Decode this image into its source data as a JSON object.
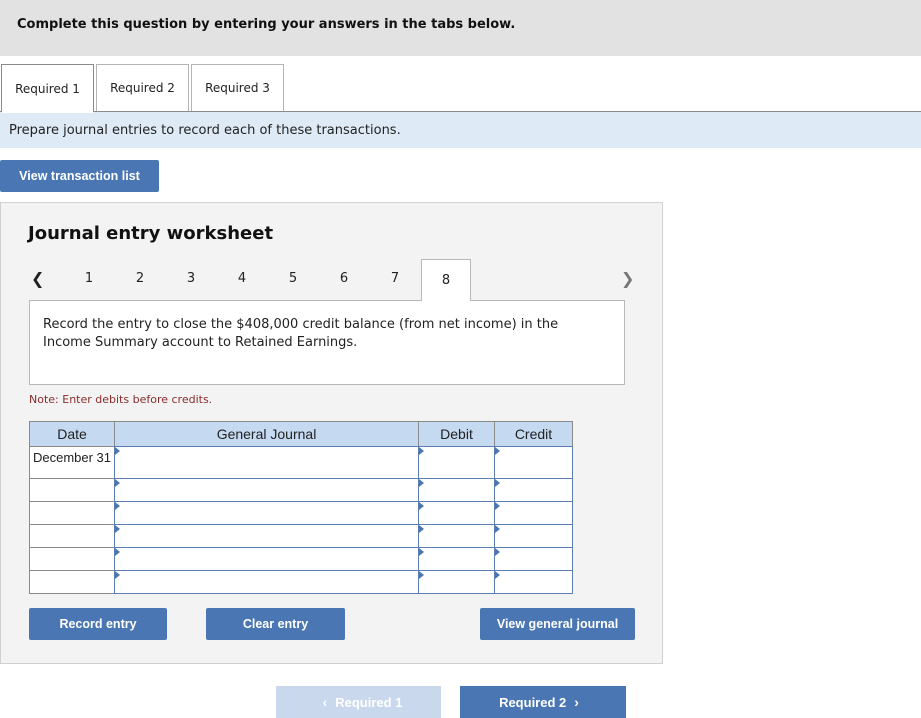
{
  "header": {
    "text": "Complete this question by entering your answers in the tabs below."
  },
  "tabs": [
    {
      "label": "Required 1",
      "active": true
    },
    {
      "label": "Required 2",
      "active": false
    },
    {
      "label": "Required 3",
      "active": false
    }
  ],
  "instruction": "Prepare journal entries to record each of these transactions.",
  "view_transaction_list_label": "View transaction list",
  "worksheet": {
    "title": "Journal entry worksheet",
    "pages": [
      "1",
      "2",
      "3",
      "4",
      "5",
      "6",
      "7",
      "8"
    ],
    "active_page": "8",
    "prev_icon": "chevron-left-icon",
    "next_icon": "chevron-right-icon",
    "description": "Record the entry to close the $408,000 credit balance (from net income) in the Income Summary account to Retained Earnings.",
    "note": "Note: Enter debits before credits.",
    "columns": {
      "date": "Date",
      "journal": "General Journal",
      "debit": "Debit",
      "credit": "Credit"
    },
    "rows": [
      {
        "date": "December 31",
        "account": "",
        "debit": "",
        "credit": ""
      },
      {
        "date": "",
        "account": "",
        "debit": "",
        "credit": ""
      },
      {
        "date": "",
        "account": "",
        "debit": "",
        "credit": ""
      },
      {
        "date": "",
        "account": "",
        "debit": "",
        "credit": ""
      },
      {
        "date": "",
        "account": "",
        "debit": "",
        "credit": ""
      },
      {
        "date": "",
        "account": "",
        "debit": "",
        "credit": ""
      }
    ],
    "buttons": {
      "record": "Record entry",
      "clear": "Clear entry",
      "view_general": "View general journal"
    }
  },
  "navigation": {
    "prev_label": "Required 1",
    "next_label": "Required 2"
  },
  "colors": {
    "button_blue": "#4a77b4",
    "header_blue": "#c5d9f1",
    "instruction_bg": "#deebf7",
    "note_red": "#8b2c2c"
  }
}
